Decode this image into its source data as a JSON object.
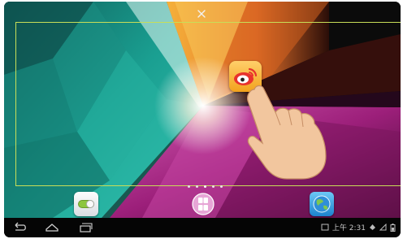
{
  "wallpaper_colors": {
    "teal": "#1aa596",
    "dark_teal": "#0d4b47",
    "orange": "#f29a25",
    "magenta": "#a3217c",
    "dark": "#0a0a0a",
    "frame": "#c8de58"
  },
  "home": {
    "close_icon": "close-icon",
    "widget_frame": "edit-frame",
    "app_icon": "weibo-icon",
    "page_indicator": {
      "count": 5,
      "active": 2
    },
    "dock": [
      "settings-icon",
      "app-drawer-icon",
      "globe-browser-icon"
    ]
  },
  "navbar": {
    "buttons": [
      "back-icon",
      "home-icon",
      "recent-apps-icon"
    ],
    "status_time": "上午 2:31"
  }
}
